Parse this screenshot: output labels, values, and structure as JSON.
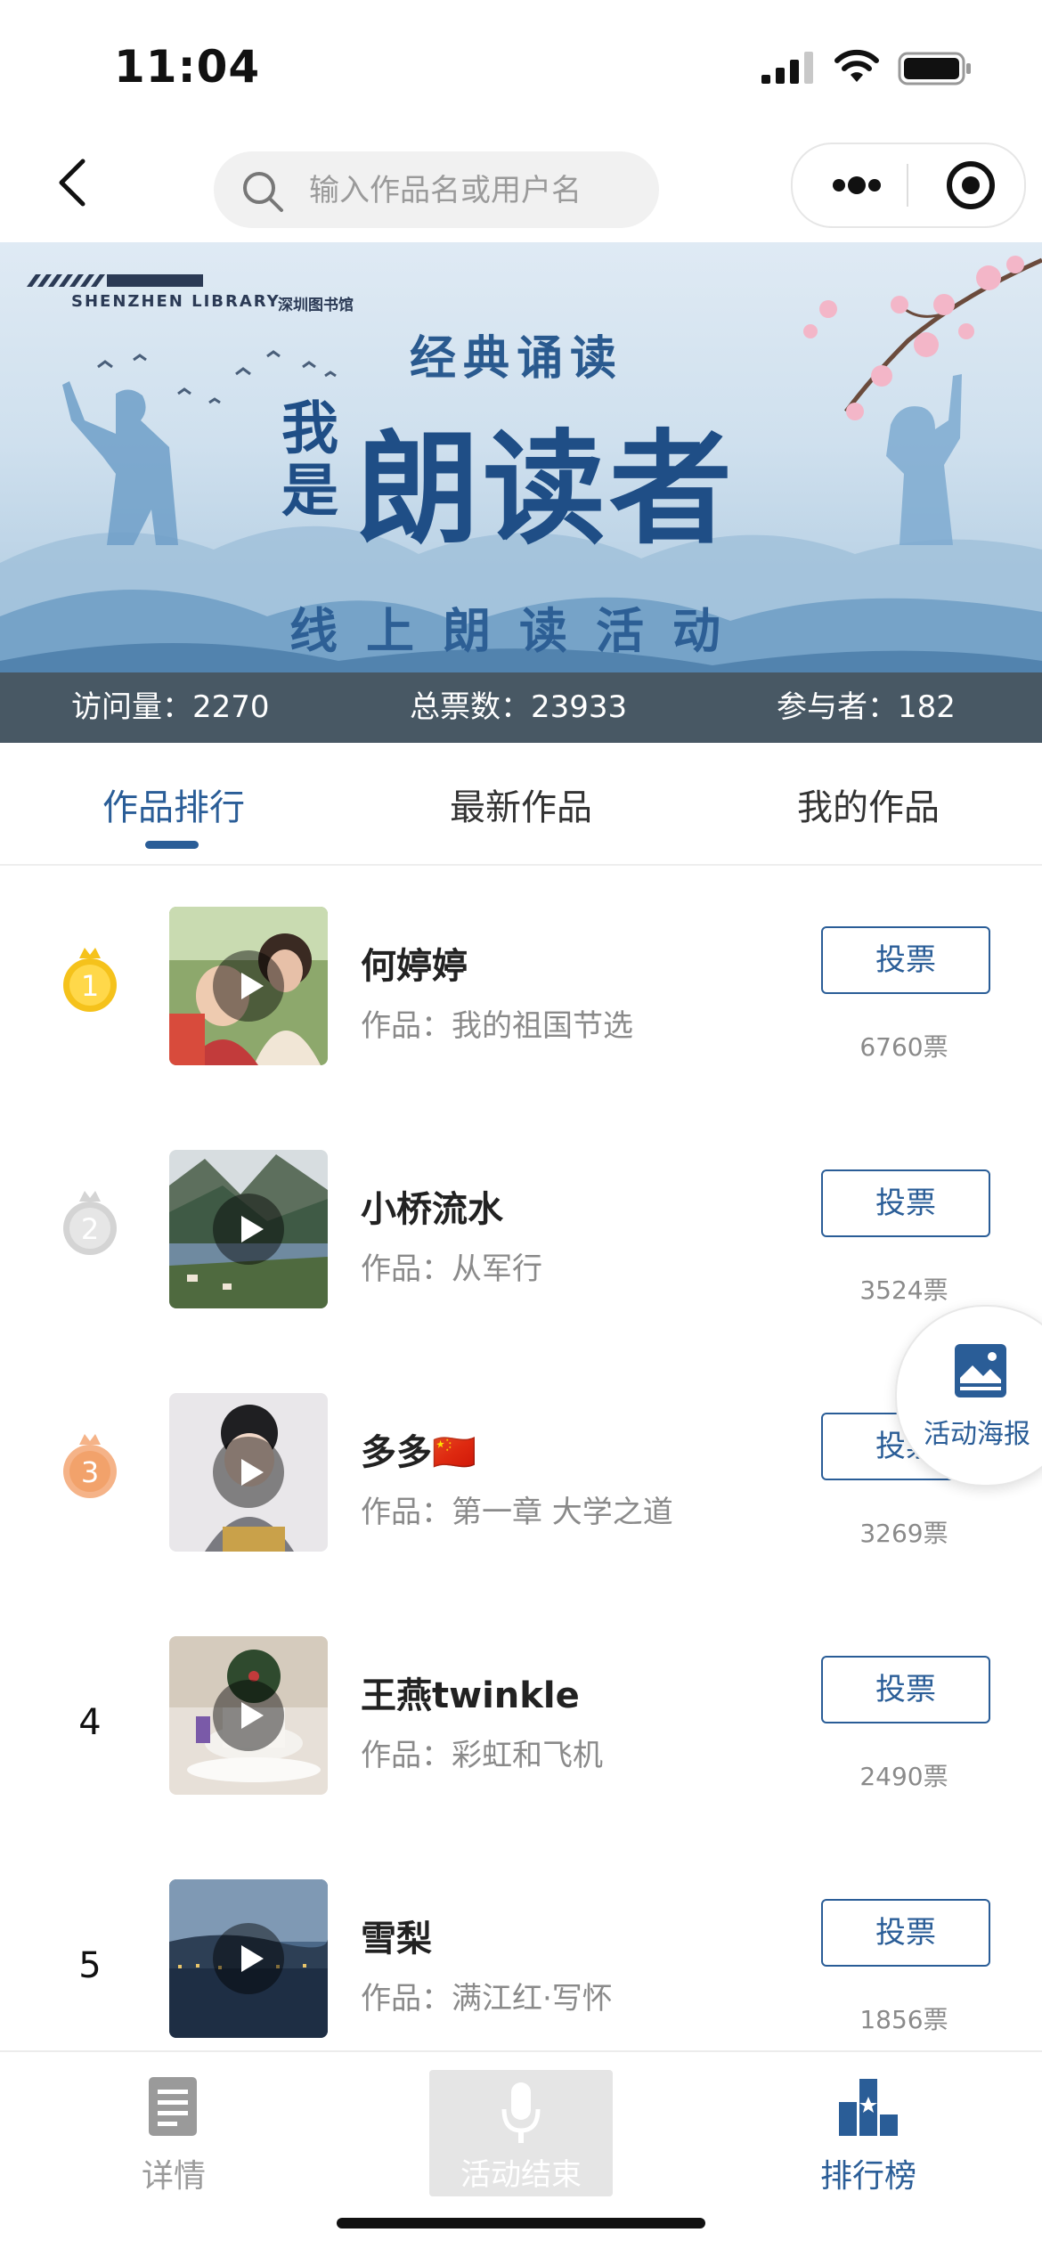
{
  "status_bar": {
    "time": "11:04"
  },
  "nav": {
    "search_placeholder": "输入作品名或用户名"
  },
  "banner": {
    "library_en": "SHENZHEN LIBRARY",
    "library_cn": "深圳图书馆",
    "subtitle": "经典诵读",
    "title_prefix": "我是",
    "title": "朗读者",
    "caption": "线上朗读活动"
  },
  "stats": {
    "visits": "访问量：2270",
    "total_votes": "总票数：23933",
    "participants": "参与者：182"
  },
  "tabs": [
    {
      "label": "作品排行",
      "active": true
    },
    {
      "label": "最新作品",
      "active": false
    },
    {
      "label": "我的作品",
      "active": false
    }
  ],
  "entries": [
    {
      "rank": "1",
      "medal": "gold",
      "name": "何婷婷",
      "work": "作品：我的祖国节选",
      "vote_label": "投票",
      "votes": "6760票"
    },
    {
      "rank": "2",
      "medal": "silver",
      "name": "小桥流水",
      "work": "作品：从军行",
      "vote_label": "投票",
      "votes": "3524票"
    },
    {
      "rank": "3",
      "medal": "bronze",
      "name": "多多🇨🇳",
      "work": "作品：第一章 大学之道",
      "vote_label": "投票",
      "votes": "3269票"
    },
    {
      "rank": "4",
      "medal": "",
      "name": "王燕twinkle",
      "work": "作品：彩虹和飞机",
      "vote_label": "投票",
      "votes": "2490票"
    },
    {
      "rank": "5",
      "medal": "",
      "name": "雪梨",
      "work": "作品：满江红·写怀",
      "vote_label": "投票",
      "votes": "1856票"
    }
  ],
  "poster": {
    "label": "活动海报"
  },
  "bottom_nav": {
    "details": "详情",
    "record": "活动结束",
    "ranking": "排行榜"
  },
  "colors": {
    "accent": "#2a5d97",
    "gold": "#f5c21b",
    "silver": "#cfcfcf",
    "bronze": "#f2a26b"
  }
}
